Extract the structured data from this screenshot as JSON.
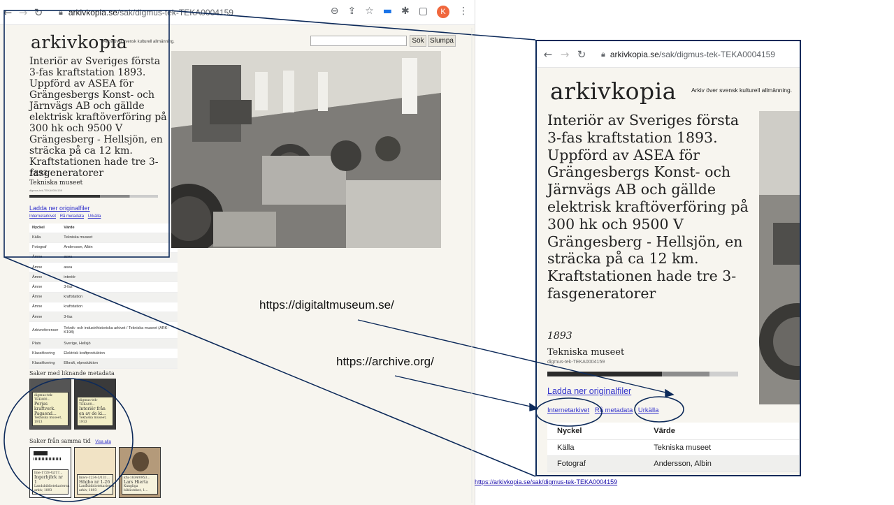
{
  "browser": {
    "url_host": "arkivkopia.se",
    "url_path": "/sak/digmus-tek-TEKA0004159",
    "profile_initial": "K"
  },
  "site": {
    "logo": "arkivkopia",
    "tagline": "Arkiv över svensk kulturell allmänning.",
    "search_button": "Sök",
    "random_button": "Slumpa"
  },
  "item": {
    "title": "Interiör av Sveriges första 3-fas kraftstation 1893. Uppförd av ASEA för Grängesbergs Konst- och Järnvägs AB och gällde elektrisk kraftöverföring på 300 hk och 9500 V Grängesberg - Hellsjön, en sträcka på ca 12 km. Kraftstationen hade tre 3-fasgeneratorer",
    "year": "1893",
    "museum": "Tekniska museet",
    "identifier": "digmus-tek-TEKA0004159",
    "download_link": "Ladda ner originalfiler",
    "links": [
      "Internetarkivet",
      "Rå metadata",
      "Urkälla"
    ]
  },
  "metadata_table": {
    "headers": [
      "Nyckel",
      "Värde"
    ],
    "rows": [
      [
        "Källa",
        "Tekniska museet"
      ],
      [
        "Fotograf",
        "Andersson, Albin"
      ],
      [
        "Ämne",
        "asea"
      ],
      [
        "Ämne",
        "asea"
      ],
      [
        "Ämne",
        "interiör"
      ],
      [
        "Ämne",
        "3-fas"
      ],
      [
        "Ämne",
        "kraftstation"
      ],
      [
        "Ämne",
        "kraftstation"
      ],
      [
        "Ämne",
        "3-fas"
      ],
      [
        "Arkivreferenser",
        "Teknik- och industrihistoriska arkivet / Tekniska museet (ARK-K198)"
      ],
      [
        "Plats",
        "Sverige, Hellsjö"
      ],
      [
        "Klassificering",
        "Elektrisk kraftproduktion"
      ],
      [
        "Klassificering",
        "Elkraft, elproduktion"
      ]
    ]
  },
  "similar_section": {
    "heading": "Saker med liknande metadata",
    "items": [
      {
        "id": "digmus-tek-TEKA00...",
        "title": "Porjus kraftverk. Pagaend...",
        "source": "Tekniska museet, 1913"
      },
      {
        "id": "digmus-tek-TEKA00...",
        "title": "Interiör från en av de ki...",
        "source": "Tekniska museet, 1913"
      }
    ]
  },
  "same_time_section": {
    "heading": "Saker från samma tid",
    "show_all": "Visa alla",
    "items": [
      {
        "id": "Ime-1728-42/17...",
        "title": "Ingerbjörk nr 1",
        "source": "Landsbibliotekarierna arkiv, 1893"
      },
      {
        "id": "lmwv-1234-3/131...",
        "title": "Högbo nr 1-26",
        "source": "Landsbibliotekarierna arkiv, 1893"
      },
      {
        "id": "kfu-1834/0953...",
        "title": "Lars Hierta",
        "source": "Kungliga biblioteket, 1..."
      }
    ]
  },
  "annotations": {
    "digitaltmuseum": "https://digitaltmuseum.se/",
    "archive": "https://archive.org/",
    "caption_url": "https://arkivkopia.se/sak/digmus-tek-TEKA0004159"
  },
  "colors": {
    "page_bg": "#f7f5ef",
    "link": "#3333cc",
    "callout_line": "#0d2a5a"
  }
}
